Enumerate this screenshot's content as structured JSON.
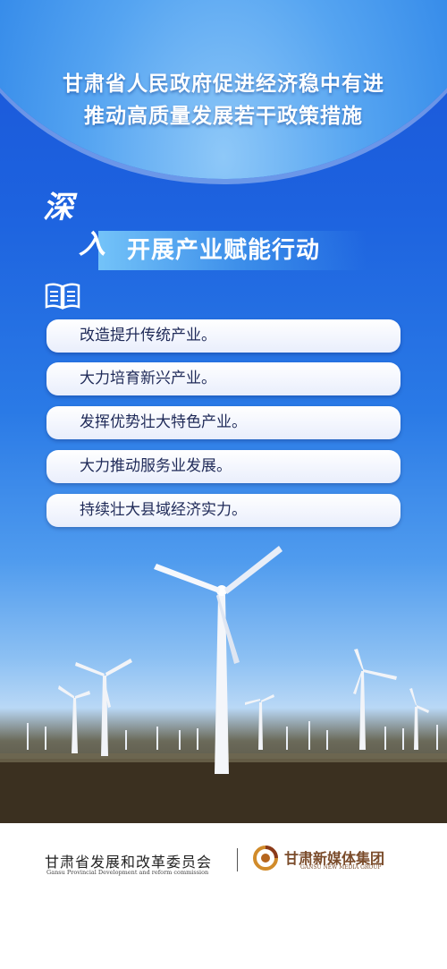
{
  "header": {
    "title_line1": "甘肃省人民政府促进经济稳中有进",
    "title_line2": "推动高质量发展若干政策措施"
  },
  "section": {
    "char1": "深",
    "char2": "入",
    "title": "开展产业赋能行动"
  },
  "measures": [
    "改造提升传统产业。",
    "大力培育新兴产业。",
    "发挥优势壮大特色产业。",
    "大力推动服务业发展。",
    "持续壮大县域经济实力。"
  ],
  "footer": {
    "org1_name": "甘肃省发展和改革委员会",
    "org1_english": "Gansu Provincial Development and reform commission",
    "org2_name": "甘肃新媒体集团",
    "org2_english": "GANSU NEW MEDIA GROUP"
  },
  "colors": {
    "sky_blue": "#1d62df",
    "item_text": "#1f2a58",
    "media_brand": "#7a4b2a"
  }
}
